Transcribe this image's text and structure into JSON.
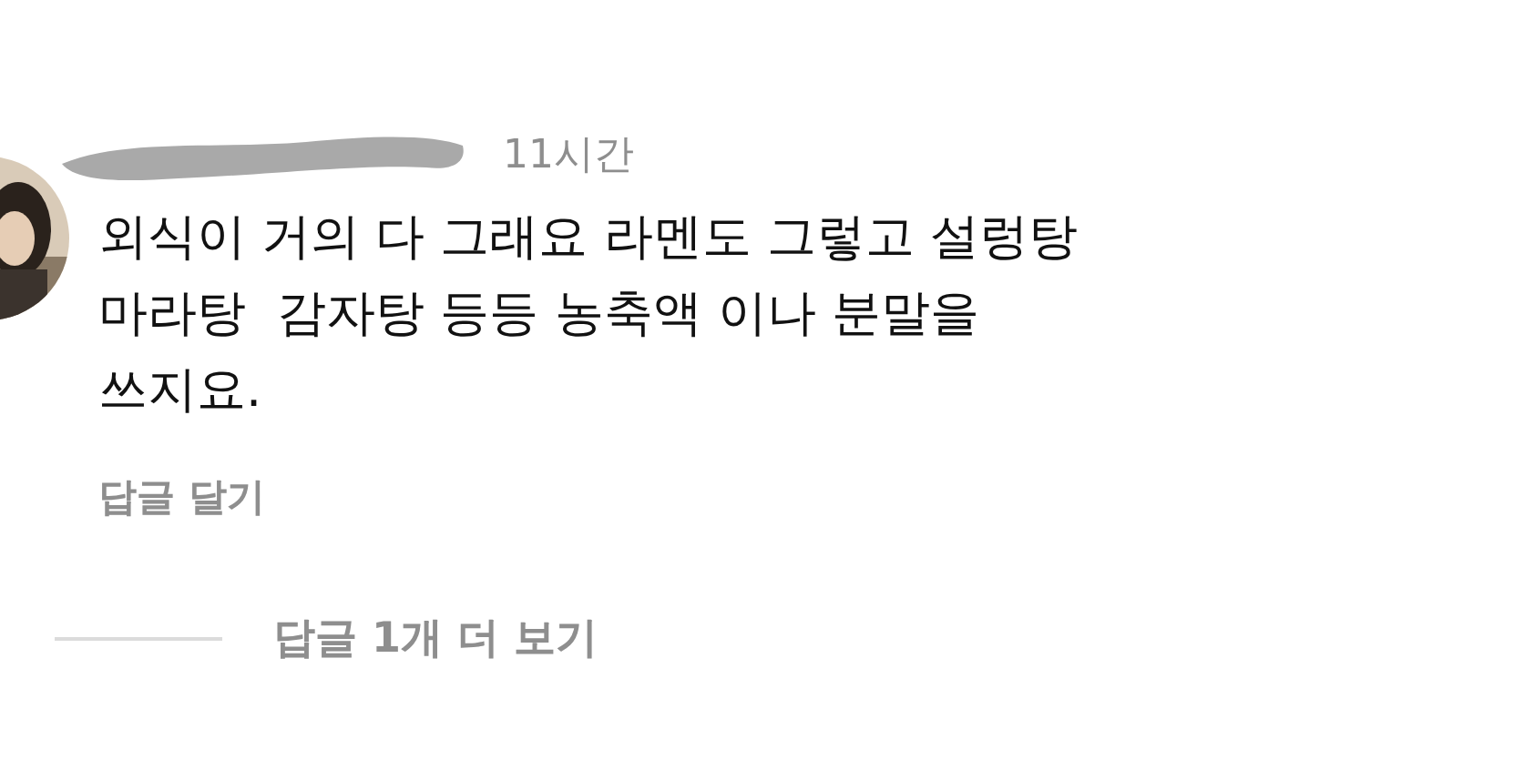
{
  "comment": {
    "username_redacted": true,
    "time": "11시간",
    "text": "외식이 거의 다 그래요 라멘도 그렇고 설렁탕\n마라탕  감자탕 등등 농축액 이나 분말을\n쓰지요.",
    "reply_link": "답글 달기"
  },
  "more_replies": {
    "label": "답글 1개 더 보기"
  }
}
